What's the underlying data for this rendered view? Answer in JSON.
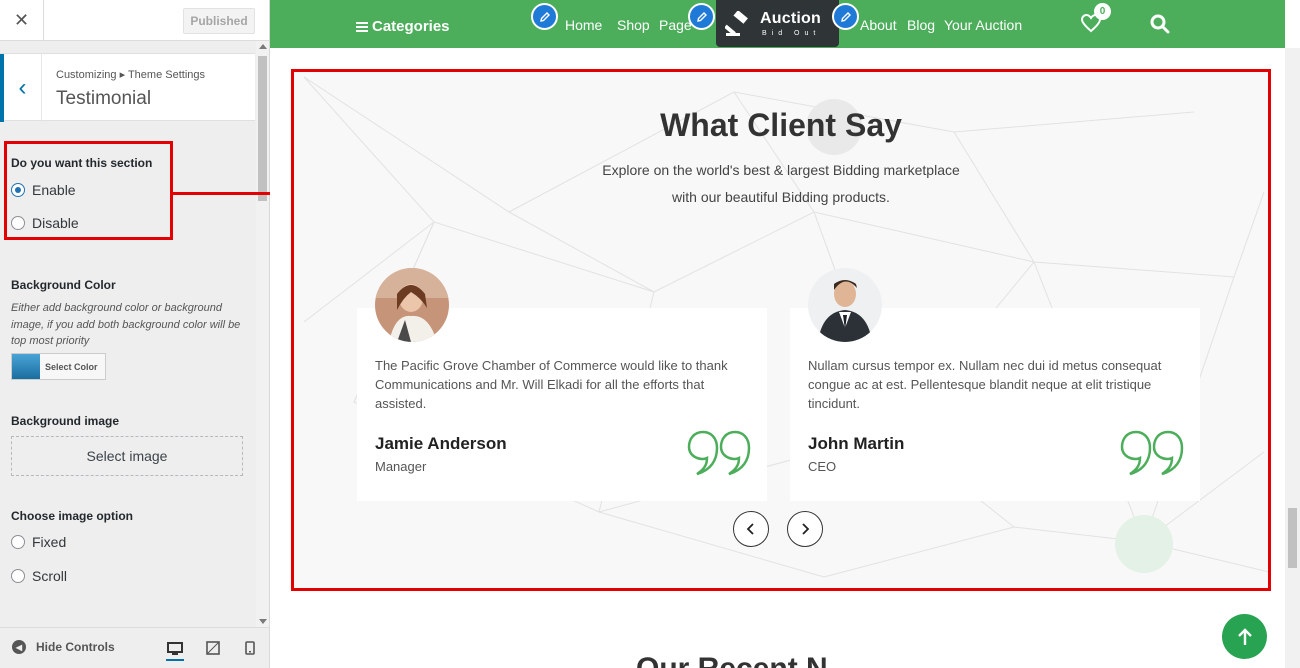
{
  "panel": {
    "close_icon": "close-icon",
    "publish_label": "Published",
    "breadcrumb": "Customizing ▸ Theme Settings",
    "section_title": "Testimonial",
    "section_toggle": {
      "label": "Do you want this section",
      "options": [
        "Enable",
        "Disable"
      ],
      "selected": "Enable"
    },
    "background_color": {
      "label": "Background Color",
      "description": "Either add background color or background image, if you add both background color will be top most priority",
      "button_label": "Select Color"
    },
    "background_image": {
      "label": "Background image",
      "button_label": "Select image"
    },
    "image_option": {
      "label": "Choose image option",
      "options": [
        "Fixed",
        "Scroll"
      ],
      "selected": null
    },
    "footer": {
      "hide_label": "Hide Controls",
      "devices": [
        "desktop",
        "tablet",
        "mobile"
      ],
      "active_device": "desktop"
    },
    "accent_color": "#0073aa",
    "highlight_color": "#e30000"
  },
  "preview": {
    "header": {
      "categories_label": "Categories",
      "nav": [
        "Home",
        "Shop",
        "Page",
        "About",
        "Blog",
        "Your Auction"
      ],
      "logo_title": "Auction",
      "logo_subtitle": "Bid Out",
      "wishlist_count": "0",
      "bar_color": "#4cae5b"
    },
    "testimonial": {
      "title": "What Client Say",
      "subtitle_line1": "Explore on the world's best & largest Bidding marketplace",
      "subtitle_line2": "with our beautiful Bidding products.",
      "cards": [
        {
          "quote": "The Pacific Grove Chamber of Commerce would like to thank Communications and Mr. Will Elkadi for all the efforts that assisted.",
          "name": "Jamie Anderson",
          "role": "Manager"
        },
        {
          "quote": "Nullam cursus tempor ex. Nullam nec dui id metus consequat congue ac at est. Pellentesque blandit neque at elit tristique tincidunt.",
          "name": "John Martin",
          "role": "CEO"
        }
      ],
      "prev_icon": "chevron-left-icon",
      "next_icon": "chevron-right-icon"
    },
    "next_section_heading": "Our Recent N",
    "scroll_top_icon": "arrow-up-icon"
  }
}
